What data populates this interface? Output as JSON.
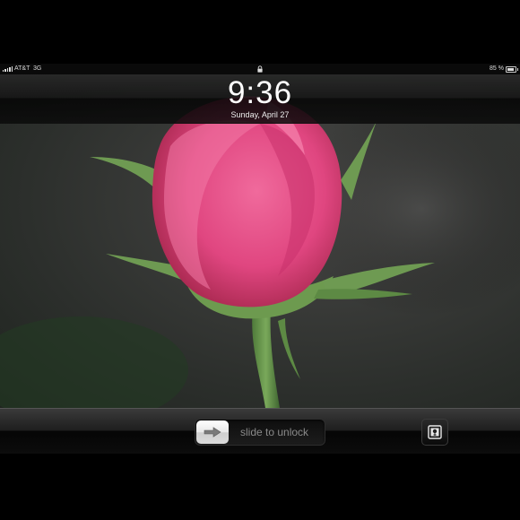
{
  "status_bar": {
    "carrier": "AT&T",
    "network": "3G",
    "battery_percent": "85 %",
    "battery_level": 0.85,
    "icons": [
      "signal-bars-icon",
      "lock-icon",
      "battery-icon"
    ]
  },
  "lock_screen": {
    "time": "9:36",
    "date": "Sunday, April 27",
    "wallpaper": "pink-rosebud-photo"
  },
  "unlock": {
    "slider_label": "slide to unlock",
    "knob_icon": "right-arrow-icon",
    "picture_frame_icon": "picture-frame-icon"
  },
  "colors": {
    "clock_text": "#ffffff",
    "band_dark": "#0a0a0a",
    "slider_text": "#8a8a8a"
  }
}
